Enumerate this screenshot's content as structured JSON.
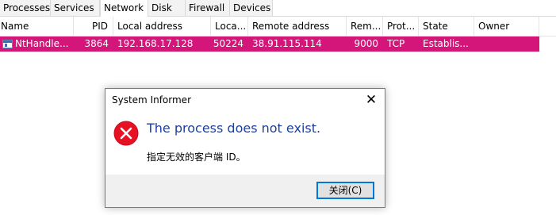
{
  "tabs": [
    {
      "label": "Processes"
    },
    {
      "label": "Services"
    },
    {
      "label": "Network",
      "active": true
    },
    {
      "label": "Disk"
    },
    {
      "label": "Firewall"
    },
    {
      "label": "Devices"
    }
  ],
  "columns": [
    "Name",
    "PID",
    "Local address",
    "Loca...",
    "Remote address",
    "Rem...",
    "Prot...",
    "State",
    "Owner"
  ],
  "row": {
    "name": "NtHandle...",
    "pid": "3864",
    "local_address": "192.168.17.128",
    "local_port": "50224",
    "remote_address": "38.91.115.114",
    "remote_port": "9000",
    "protocol": "TCP",
    "state": "Establis...",
    "owner": "",
    "highlight_color": "#d4157a"
  },
  "dialog": {
    "title": "System Informer",
    "close_glyph": "✕",
    "icon": "error-icon",
    "main_text": "The process does not exist.",
    "sub_text": "指定无效的客户端 ID。",
    "button_label": "关闭(C)"
  }
}
